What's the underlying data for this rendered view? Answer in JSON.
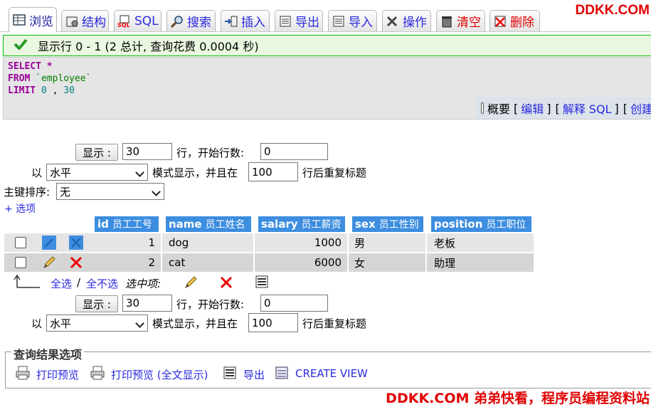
{
  "tabs": [
    {
      "label": "浏览",
      "icon": "table-icon",
      "active": true
    },
    {
      "label": "结构",
      "icon": "structure-icon"
    },
    {
      "label": "SQL",
      "icon": "sql-icon"
    },
    {
      "label": "搜索",
      "icon": "search-icon"
    },
    {
      "label": "插入",
      "icon": "insert-icon"
    },
    {
      "label": "导出",
      "icon": "export-icon"
    },
    {
      "label": "导入",
      "icon": "import-icon"
    },
    {
      "label": "操作",
      "icon": "wrench-icon"
    },
    {
      "label": "清空",
      "icon": "trash-icon"
    },
    {
      "label": "删除",
      "icon": "delete-icon"
    }
  ],
  "brand_top": "DDKK.COM",
  "status": {
    "text": "显示行 0 - 1 (2 总计, 查询花费 0.0004 秒)"
  },
  "sql": {
    "select": "SELECT",
    "star": "*",
    "from": "FROM",
    "table": "`employee`",
    "limit": "LIMIT",
    "offset": "0",
    "comma": ",",
    "count": "30"
  },
  "sql_options": {
    "profile": "概要",
    "edit": "编辑",
    "explain": "解释 SQL",
    "create": "创建",
    "open": "[",
    "close": "]"
  },
  "nav_top": {
    "show_label": "显示 :",
    "rows_value": "30",
    "rows_text": "行，开始行数:",
    "start_value": "0",
    "in_text": "以",
    "mode_value": "水平",
    "mode_text": "模式显示，并且在",
    "repeat_value": "100",
    "repeat_text": "行后重复标题"
  },
  "sort": {
    "label": "主键排序:",
    "value": "无"
  },
  "options_link": "+ 选项",
  "columns": [
    {
      "key": "id",
      "comment": "员工工号"
    },
    {
      "key": "name",
      "comment": "员工姓名"
    },
    {
      "key": "salary",
      "comment": "员工薪资"
    },
    {
      "key": "sex",
      "comment": "员工性别"
    },
    {
      "key": "position",
      "comment": "员工职位"
    }
  ],
  "rows": [
    {
      "id": "1",
      "name": "dog",
      "salary": "1000",
      "sex": "男",
      "position": "老板"
    },
    {
      "id": "2",
      "name": "cat",
      "salary": "6000",
      "sex": "女",
      "position": "助理"
    }
  ],
  "bulk": {
    "check_all": "全选",
    "slash": "/",
    "uncheck_all": "全不选",
    "selected": "选中项:"
  },
  "nav_bottom": {
    "show_label": "显示 :",
    "rows_value": "30",
    "rows_text": "行，开始行数:",
    "start_value": "0",
    "in_text": "以",
    "mode_value": "水平",
    "mode_text": "模式显示，并且在",
    "repeat_value": "100",
    "repeat_text": "行后重复标题"
  },
  "query_results": {
    "legend": "查询结果选项",
    "print_view": "打印预览",
    "print_view_full": "打印预览 (全文显示)",
    "export": "导出",
    "create_view": "CREATE VIEW"
  },
  "brand_bottom": "DDKK.COM 弟弟快看，程序员编程资料站",
  "colors": {
    "header": "#3d8ee0",
    "link": "#2a2ae0",
    "brand": "#e00000",
    "row_odd": "#e5e5e5",
    "row_even": "#d5d5d5"
  }
}
